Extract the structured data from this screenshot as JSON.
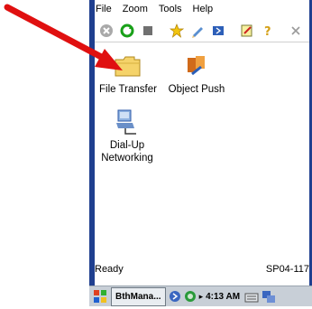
{
  "menu": [
    "File",
    "Zoom",
    "Tools",
    "Help"
  ],
  "toolbar_icons": [
    "stop-icon",
    "refresh-icon",
    "stop-square-icon",
    "favorites-star-icon",
    "edit-icon",
    "bluetooth-book-icon",
    "notes-icon",
    "help-icon",
    "close-icon"
  ],
  "items": [
    {
      "label": "File Transfer",
      "icon": "folder-icon"
    },
    {
      "label": "Object Push",
      "icon": "object-push-icon"
    },
    {
      "label": "Dial-Up Networking",
      "icon": "dialup-networking-icon"
    }
  ],
  "status": {
    "left": "Ready",
    "right": "SP04-117"
  },
  "taskbar": {
    "task_label": "BthMana...",
    "time": "4:13 AM"
  },
  "colors": {
    "edge": "#1f3f8f",
    "arrow": "#e01010"
  }
}
